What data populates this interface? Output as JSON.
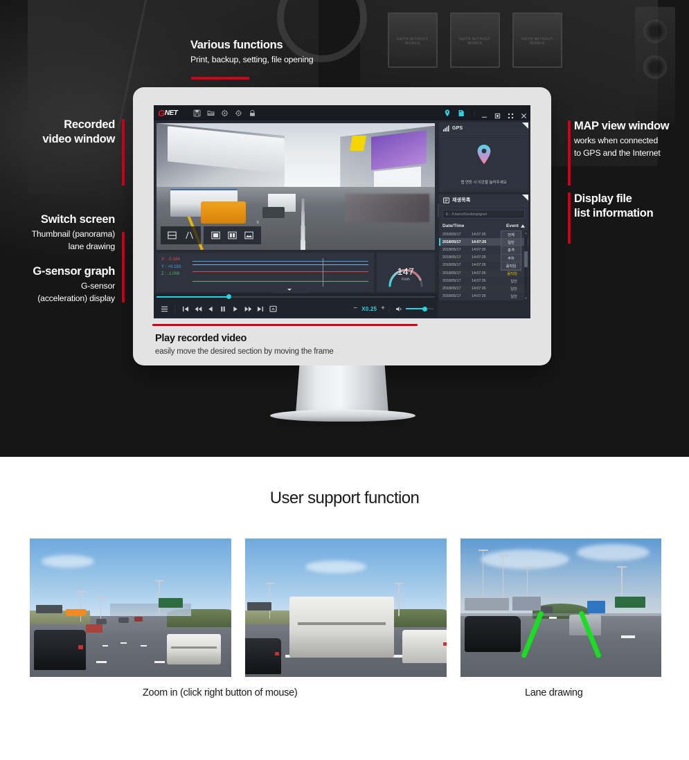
{
  "callouts": {
    "various": {
      "title": "Various functions",
      "sub": "Print, backup, setting, file opening"
    },
    "recorded": {
      "title_line1": "Recorded",
      "title_line2": "video window"
    },
    "switch": {
      "title": "Switch screen",
      "sub_line1": "Thumbnail (panorama)",
      "sub_line2": "lane drawing"
    },
    "gsensor": {
      "title": "G-sensor graph",
      "sub_line1": "G-sensor",
      "sub_line2": "(acceleration) display"
    },
    "map": {
      "title": "MAP view window",
      "sub_line1": "works when connected",
      "sub_line2": "to GPS and the Internet"
    },
    "filelist": {
      "title_line1": "Display file",
      "title_line2": "list information"
    },
    "play": {
      "title": "Play recorded video",
      "sub": "easily move the desired section by moving the frame"
    }
  },
  "app": {
    "logo_g": "G",
    "logo_net": "NET",
    "toolbar_icons": [
      "save-icon",
      "folder-open-icon",
      "print-icon",
      "settings-icon",
      "lock-icon"
    ],
    "status_icons": [
      "location-pin-icon",
      "sd-card-icon"
    ],
    "window_buttons": [
      "minimize-button",
      "maximize-button",
      "fullscreen-button",
      "close-button"
    ],
    "video_overlay": {
      "left_icons": [
        "split-screen-icon",
        "lane-drawing-icon"
      ],
      "popup_icons": [
        "single-view-icon",
        "dual-view-icon",
        "panorama-view-icon"
      ],
      "close_label": "x"
    },
    "gsensor": {
      "x_label": "X :",
      "x_value": "-0.184",
      "y_label": "Y :",
      "y_value": "+0.193",
      "z_label": "Z :",
      "z_value": "-1.008"
    },
    "speed": {
      "value": "147",
      "unit": "Km/h"
    },
    "controls": {
      "menu": "menu-icon",
      "buttons": [
        "skip-start-icon",
        "rewind-icon",
        "step-back-icon",
        "pause-icon",
        "play-icon",
        "fast-forward-icon",
        "skip-end-icon",
        "capture-icon"
      ],
      "speed_minus": "−",
      "speed_value": "X0.25",
      "speed_plus": "+",
      "volume_icon": "volume-icon"
    },
    "gps_panel": {
      "title": "GPS",
      "icon": "signal-bars-icon",
      "message": "맵 연동 시 이곳을 눌러주세요"
    },
    "playlist_panel": {
      "title": "재생목록",
      "icon": "playlist-icon",
      "path_value": "E : /Users/Desktop/gnet",
      "col_datetime": "Date/Time",
      "col_event": "Event",
      "sort_icon": "caret-up-icon",
      "dropdown_options": [
        "전체",
        "일반",
        "충격",
        "주차",
        "움직임"
      ],
      "dropdown_selected": "일반",
      "rows": [
        {
          "date": "2018/05/17",
          "time": "14:07:26",
          "event": "",
          "selected": false
        },
        {
          "date": "2018/05/17",
          "time": "14:07:26",
          "event": "",
          "selected": true
        },
        {
          "date": "2018/05/17",
          "time": "14:07:26",
          "event": "",
          "selected": false
        },
        {
          "date": "2018/05/17",
          "time": "14:07:26",
          "event": "",
          "selected": false
        },
        {
          "date": "2018/05/17",
          "time": "14:07:26",
          "event": "",
          "selected": false
        },
        {
          "date": "2018/05/17",
          "time": "14:07:26",
          "event": "움직임",
          "selected": false
        },
        {
          "date": "2018/05/17",
          "time": "14:07:26",
          "event": "일반",
          "selected": false
        },
        {
          "date": "2018/05/17",
          "time": "14:07:26",
          "event": "일반",
          "selected": false
        },
        {
          "date": "2018/05/17",
          "time": "14:07:26",
          "event": "일반",
          "selected": false
        }
      ]
    }
  },
  "support": {
    "title": "User support function",
    "caption1": "Zoom in (click right button of mouse)",
    "caption3": "Lane drawing"
  },
  "colors": {
    "accent_red": "#d0021b",
    "brand_red": "#e1161d",
    "cyan": "#2ad3e0",
    "event_yellow": "#e8c200",
    "lane_green": "#18e020",
    "app_bg": "#262a33",
    "panel_bg": "#2e333d"
  },
  "bg_posters": [
    "FAITH WITHOUT WORKS",
    "FAITH WITHOUT WORKS",
    "FAITH WITHOUT WORKS"
  ]
}
